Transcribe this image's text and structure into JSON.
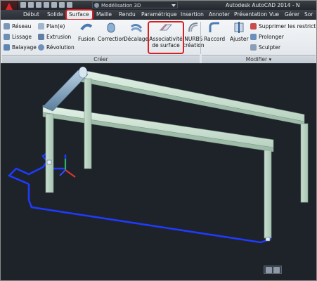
{
  "app": {
    "title": "Autodesk AutoCAD 2014 - N"
  },
  "workspace": {
    "value": "Modélisation 3D"
  },
  "tabs": [
    {
      "label": "Début"
    },
    {
      "label": "Solide"
    },
    {
      "label": "Surface"
    },
    {
      "label": "Maille"
    },
    {
      "label": "Rendu"
    },
    {
      "label": "Paramétrique"
    },
    {
      "label": "Insertion"
    },
    {
      "label": "Annoter"
    },
    {
      "label": "Présentation"
    },
    {
      "label": "Vue"
    },
    {
      "label": "Gérer"
    },
    {
      "label": "Sor"
    }
  ],
  "ribbon": {
    "creer": {
      "reseau": "Réseau",
      "lissage": "Lissage",
      "balayage": "Balayage",
      "plan": "Plan(e)",
      "extrusion": "Extrusion",
      "revolution": "Révolution",
      "fusion": "Fusion",
      "correction": "Correction",
      "decalage": "Décalage",
      "assoc_line1": "Associativité",
      "assoc_line2": "de surface",
      "nurbs_line1": "NURBS",
      "nurbs_line2": "création",
      "panel": "Créer"
    },
    "modifier": {
      "raccord": "Raccord",
      "ajuster": "Ajuster",
      "supprimer": "Supprimer les restrictions",
      "prolonger": "Prolonger",
      "sculpter": "Sculpter",
      "panel": "Modifier ▾"
    }
  },
  "colors": {
    "highlight": "#d91f22",
    "ribbon_bg": "#eef1f4",
    "viewport_bg": "#1e232a",
    "beam": "#d2e6d8",
    "polyline": "#1f3bff"
  }
}
